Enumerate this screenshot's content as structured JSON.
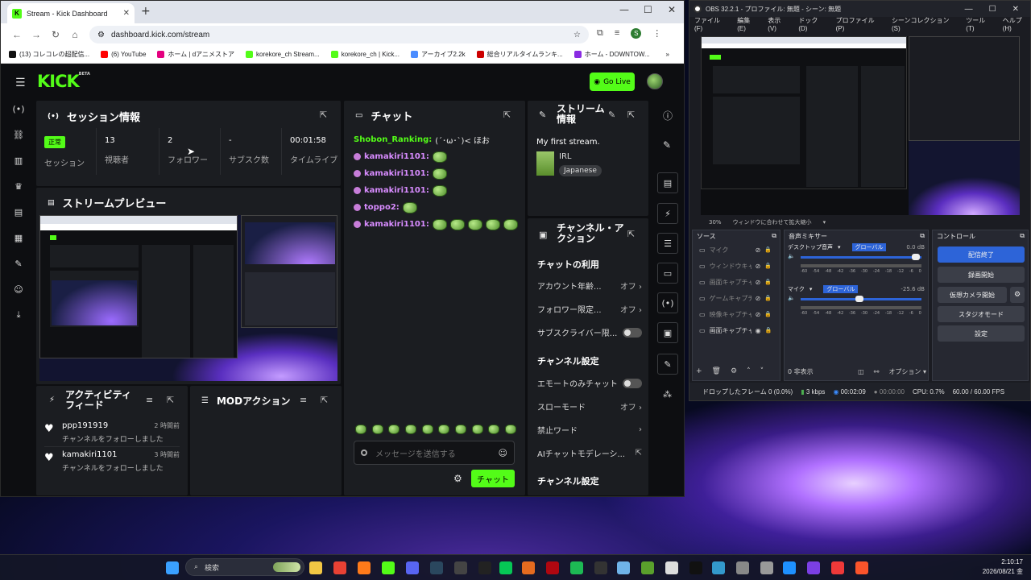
{
  "browser": {
    "tab_title": "Stream - Kick Dashboard",
    "url": "dashboard.kick.com/stream",
    "bookmarks": [
      {
        "label": "(13) コレコレの超配信...",
        "color": "#111"
      },
      {
        "label": "(6) YouTube",
        "color": "#ff0000"
      },
      {
        "label": "ホーム | dアニメストア",
        "color": "#e4007f"
      },
      {
        "label": "korekore_ch Stream...",
        "color": "#53fc18"
      },
      {
        "label": "korekore_ch | Kick...",
        "color": "#53fc18"
      },
      {
        "label": "アーカイブ2.2k",
        "color": "#4a8cff"
      },
      {
        "label": "総合リアルタイムランキ...",
        "color": "#cc0000"
      },
      {
        "label": "ホーム - DOWNTOW...",
        "color": "#8a2be2"
      }
    ]
  },
  "kick": {
    "logo": "KICK",
    "logo_beta": "BETA",
    "go_live": "Go Live",
    "session": {
      "title": "セッション情報",
      "status_badge": "正常",
      "status_label": "セッション",
      "viewers_value": "13",
      "viewers_label": "視聴者",
      "followers_value": "2",
      "followers_label": "フォロワー",
      "subs_value": "-",
      "subs_label": "サブスク数",
      "time_value": "00:01:58",
      "time_label": "タイムライブ"
    },
    "preview": {
      "title": "ストリームプレビュー"
    },
    "activity": {
      "title": "アクティビティフィード",
      "items": [
        {
          "user": "ppp191919",
          "time": "2 時間前",
          "text": "チャンネルをフォローしました"
        },
        {
          "user": "kamakiri1101",
          "time": "3 時間前",
          "text": "チャンネルをフォローしました"
        }
      ]
    },
    "mod": {
      "title": "MODアクション"
    },
    "chat": {
      "title": "チャット",
      "first_user": "Shobon_Ranking:",
      "first_msg": "(´･ω･`)< ほお",
      "lines": [
        {
          "user": "kamakiri1101:",
          "emotes": 1
        },
        {
          "user": "kamakiri1101:",
          "emotes": 1
        },
        {
          "user": "kamakiri1101:",
          "emotes": 1
        },
        {
          "user": "toppo2:",
          "emotes": 1
        },
        {
          "user": "kamakiri1101:",
          "emotes": 5
        }
      ],
      "placeholder": "メッセージを送信する",
      "send": "チャット"
    },
    "stream_info": {
      "title": "ストリーム情報",
      "stream_title": "My first stream.",
      "category": "IRL",
      "language": "Japanese"
    },
    "channel_actions": {
      "title": "チャンネル・アクション",
      "chat_usage": "チャットの利用",
      "account_age": "アカウント年齢...",
      "account_age_val": "オフ",
      "follower_only": "フォロワー限定...",
      "follower_only_val": "オフ",
      "sub_only": "サブスクライバー限...",
      "channel_settings": "チャンネル設定",
      "emote_only": "エモートのみチャット",
      "slow_mode": "スローモード",
      "slow_mode_val": "オフ",
      "banned_words": "禁止ワード",
      "ai_mod": "AIチャットモデレーシ...",
      "channel_settings2": "チャンネル設定"
    }
  },
  "obs": {
    "title": "OBS 32.2.1 - プロファイル: 無題 - シーン: 無題",
    "menu": [
      "ファイル(F)",
      "編集(E)",
      "表示(V)",
      "ドック(D)",
      "プロファイル(P)",
      "シーンコレクション(S)",
      "ツール(T)",
      "ヘルプ(H)"
    ],
    "zoom": "30%",
    "fit_label": "ウィンドウに合わせて拡大縮小",
    "sources_title": "ソース",
    "sources": [
      {
        "name": "マイク",
        "visible": false
      },
      {
        "name": "ウィンドウキャプ",
        "visible": false
      },
      {
        "name": "画面キャプチャ",
        "visible": false
      },
      {
        "name": "ゲームキャプチャ",
        "visible": false
      },
      {
        "name": "映像キャプチャ",
        "visible": false
      },
      {
        "name": "画面キャプチャ",
        "visible": true
      }
    ],
    "mixer_title": "音声ミキサー",
    "mixer": [
      {
        "name": "デスクトップ音声",
        "tag": "グローバル",
        "db": "0.0 dB",
        "level": 0.92
      },
      {
        "name": "マイク",
        "tag": "グローバル",
        "db": "-25.6 dB",
        "level": 0.45
      }
    ],
    "scale_ticks": [
      "-60",
      "-54",
      "-48",
      "-42",
      "-36",
      "-30",
      "-24",
      "-18",
      "-12",
      "-6",
      "0"
    ],
    "hidden_label": "0 非表示",
    "options_label": "オプション",
    "controls_title": "コントロール",
    "controls": [
      "配信終了",
      "録画開始",
      "仮想カメラ開始",
      "スタジオモード",
      "設定"
    ],
    "status": {
      "dropped": "ドロップしたフレーム 0 (0.0%)",
      "kbps": "3 kbps",
      "live_time": "00:02:09",
      "rec_time": "00:00:00",
      "cpu": "CPU: 0.7%",
      "fps": "60.00 / 60.00 FPS"
    }
  },
  "taskbar": {
    "search": "検索",
    "time": "2:10:17",
    "date": "2026/08/21 金",
    "apps": [
      {
        "name": "start",
        "color": "#3aa0ff"
      },
      {
        "name": "explorer",
        "color": "#f2c744"
      },
      {
        "name": "chrome",
        "color": "#e84134"
      },
      {
        "name": "firefox",
        "color": "#ff7a1a"
      },
      {
        "name": "kick",
        "color": "#53fc18"
      },
      {
        "name": "discord",
        "color": "#5865f2"
      },
      {
        "name": "steam",
        "color": "#2a475e"
      },
      {
        "name": "obs",
        "color": "#444"
      },
      {
        "name": "app-dark",
        "color": "#222"
      },
      {
        "name": "line",
        "color": "#06c755"
      },
      {
        "name": "app-orange",
        "color": "#e66b1f"
      },
      {
        "name": "netflix",
        "color": "#b00710"
      },
      {
        "name": "spotify",
        "color": "#1db954"
      },
      {
        "name": "epic",
        "color": "#333"
      },
      {
        "name": "notepad",
        "color": "#6fb3e8"
      },
      {
        "name": "minecraft",
        "color": "#5aa02c"
      },
      {
        "name": "app-white",
        "color": "#ddd"
      },
      {
        "name": "terminal",
        "color": "#111"
      },
      {
        "name": "app-bubble",
        "color": "#39c"
      },
      {
        "name": "settings",
        "color": "#888"
      },
      {
        "name": "security",
        "color": "#999"
      },
      {
        "name": "edge",
        "color": "#1e90ff"
      },
      {
        "name": "app-purple",
        "color": "#7b3fe4"
      },
      {
        "name": "vivaldi",
        "color": "#ef3939"
      },
      {
        "name": "brave",
        "color": "#fb542b"
      }
    ]
  }
}
